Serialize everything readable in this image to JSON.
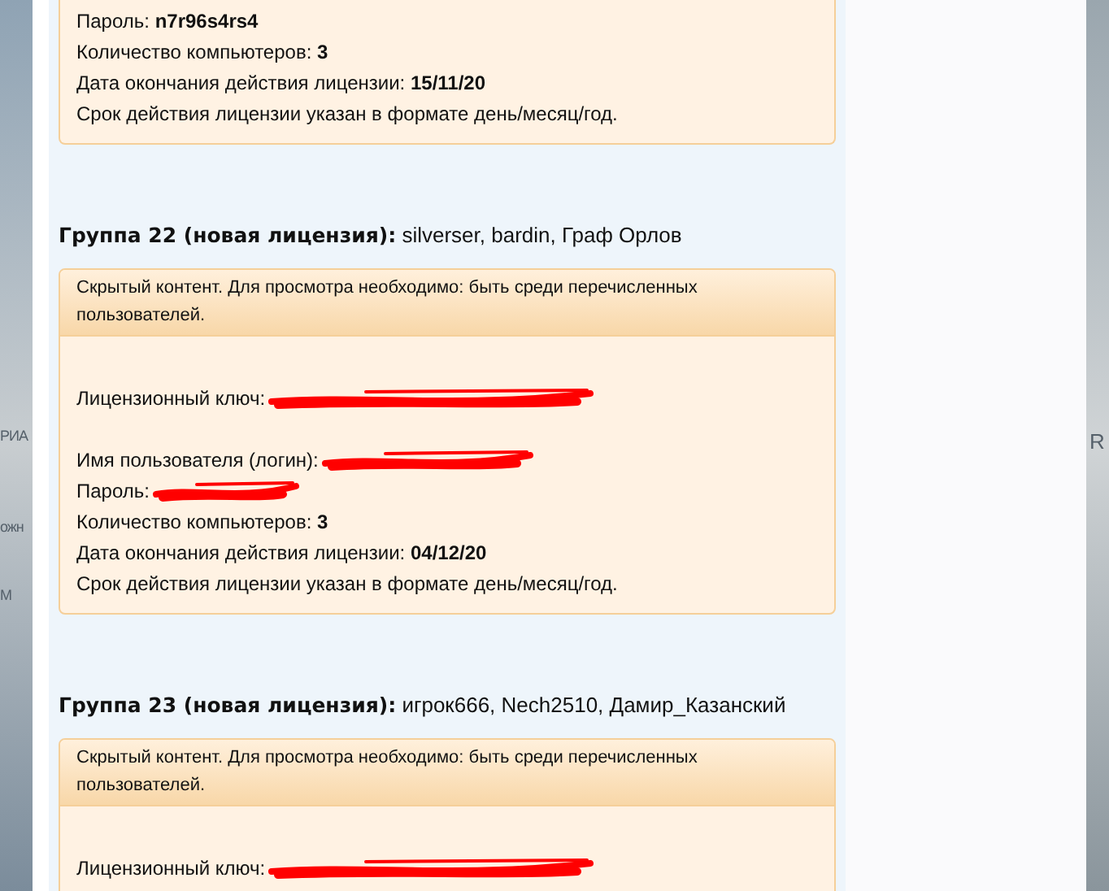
{
  "left_fragments": [
    "РИА",
    "ожн",
    "М"
  ],
  "right_fragments": [
    "R"
  ],
  "sections": [
    {
      "kind": "continued",
      "lines": [
        {
          "kind": "value",
          "label": "Пароль:",
          "value": "n7r96s4rs4"
        },
        {
          "kind": "value",
          "label": "Количество компьютеров:",
          "value": "3"
        },
        {
          "kind": "value",
          "label": "Дата окончания действия лицензии:",
          "value": "15/11/20"
        },
        {
          "kind": "plain",
          "label": "Срок действия лицензии указан в формате день/месяц/год."
        }
      ]
    },
    {
      "kind": "group",
      "heading": "Группа 22 (новая лицензия):",
      "names": "silverser, bardin, Граф Орлов",
      "notice": "Скрытый контент. Для просмотра необходимо: быть среди перечисленных пользователей.",
      "lines": [
        {
          "kind": "blank"
        },
        {
          "kind": "redacted",
          "label": "Лицензионный ключ:"
        },
        {
          "kind": "blank"
        },
        {
          "kind": "redacted",
          "label": "Имя пользователя (логин):"
        },
        {
          "kind": "redacted",
          "label": "Пароль:"
        },
        {
          "kind": "value",
          "label": "Количество компьютеров:",
          "value": "3"
        },
        {
          "kind": "value",
          "label": "Дата окончания действия лицензии:",
          "value": "04/12/20"
        },
        {
          "kind": "plain",
          "label": "Срок действия лицензии указан в формате день/месяц/год."
        }
      ]
    },
    {
      "kind": "group",
      "heading": "Группа 23 (новая лицензия):",
      "names": "игрок666, Nech2510, Дамир_Казанский",
      "notice": "Скрытый контент. Для просмотра необходимо: быть среди перечисленных пользователей.",
      "lines": [
        {
          "kind": "blank"
        },
        {
          "kind": "redacted",
          "label": "Лицензионный ключ:"
        }
      ]
    }
  ]
}
